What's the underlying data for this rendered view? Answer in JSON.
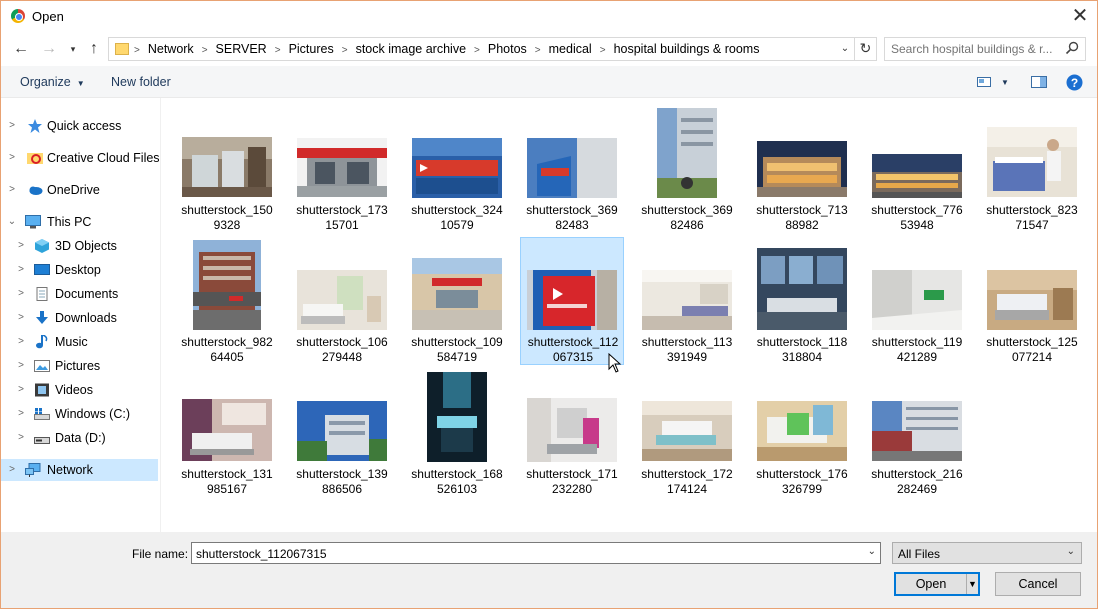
{
  "window": {
    "title": "Open"
  },
  "address": {
    "crumbs": [
      "Network",
      "SERVER",
      "Pictures",
      "stock image archive",
      "Photos",
      "medical",
      "hospital buildings & rooms"
    ]
  },
  "search": {
    "placeholder": "Search hospital buildings & r..."
  },
  "toolbar": {
    "organize": "Organize",
    "new_folder": "New folder"
  },
  "sidebar": {
    "items": [
      {
        "label": "Quick access",
        "icon": "star-icon"
      },
      {
        "label": "Creative Cloud Files",
        "icon": "creative-cloud-icon"
      },
      {
        "label": "OneDrive",
        "icon": "cloud-icon"
      },
      {
        "label": "This PC",
        "icon": "computer-icon"
      },
      {
        "label": "3D Objects",
        "icon": "cube-icon"
      },
      {
        "label": "Desktop",
        "icon": "desktop-icon"
      },
      {
        "label": "Documents",
        "icon": "document-icon"
      },
      {
        "label": "Downloads",
        "icon": "download-icon"
      },
      {
        "label": "Music",
        "icon": "music-icon"
      },
      {
        "label": "Pictures",
        "icon": "pictures-icon"
      },
      {
        "label": "Videos",
        "icon": "film-icon"
      },
      {
        "label": "Windows (C:)",
        "icon": "windows-drive-icon"
      },
      {
        "label": "Data (D:)",
        "icon": "drive-icon"
      },
      {
        "label": "Network",
        "icon": "network-icon"
      }
    ]
  },
  "files": [
    {
      "line1": "shutterstock_150",
      "line2": "9328"
    },
    {
      "line1": "shutterstock_173",
      "line2": "15701"
    },
    {
      "line1": "shutterstock_324",
      "line2": "10579"
    },
    {
      "line1": "shutterstock_369",
      "line2": "82483"
    },
    {
      "line1": "shutterstock_369",
      "line2": "82486"
    },
    {
      "line1": "shutterstock_713",
      "line2": "88982"
    },
    {
      "line1": "shutterstock_776",
      "line2": "53948"
    },
    {
      "line1": "shutterstock_823",
      "line2": "71547"
    },
    {
      "line1": "shutterstock_982",
      "line2": "64405"
    },
    {
      "line1": "shutterstock_106",
      "line2": "279448"
    },
    {
      "line1": "shutterstock_109",
      "line2": "584719"
    },
    {
      "line1": "shutterstock_112",
      "line2": "067315"
    },
    {
      "line1": "shutterstock_113",
      "line2": "391949"
    },
    {
      "line1": "shutterstock_118",
      "line2": "318804"
    },
    {
      "line1": "shutterstock_119",
      "line2": "421289"
    },
    {
      "line1": "shutterstock_125",
      "line2": "077214"
    },
    {
      "line1": "shutterstock_131",
      "line2": "985167"
    },
    {
      "line1": "shutterstock_139",
      "line2": "886506"
    },
    {
      "line1": "shutterstock_168",
      "line2": "526103"
    },
    {
      "line1": "shutterstock_171",
      "line2": "232280"
    },
    {
      "line1": "shutterstock_172",
      "line2": "174124"
    },
    {
      "line1": "shutterstock_176",
      "line2": "326799"
    },
    {
      "line1": "shutterstock_216",
      "line2": "282469"
    }
  ],
  "bottom": {
    "file_name_label": "File name:",
    "file_name_value": "shutterstock_112067315",
    "filter_value": "All Files",
    "open_label": "Open",
    "cancel_label": "Cancel"
  },
  "colors": {
    "selection_bg": "#cce8ff",
    "selection_border": "#99d1ff",
    "accent": "#0078d7",
    "window_border": "#e8a273"
  }
}
